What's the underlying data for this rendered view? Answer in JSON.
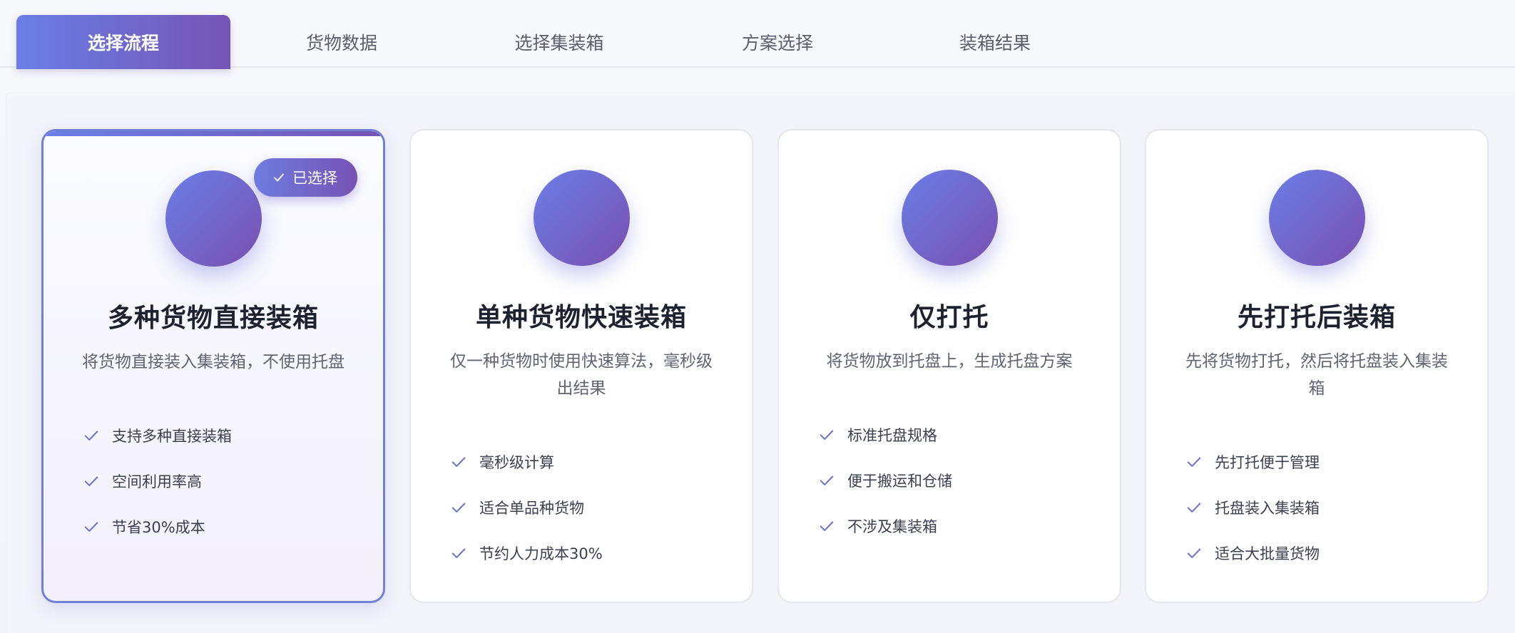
{
  "tabs": [
    {
      "label": "选择流程",
      "active": true
    },
    {
      "label": "货物数据",
      "active": false
    },
    {
      "label": "选择集装箱",
      "active": false
    },
    {
      "label": "方案选择",
      "active": false
    },
    {
      "label": "装箱结果",
      "active": false
    }
  ],
  "badge": {
    "label": "已选择",
    "icon": "check-icon"
  },
  "cards": [
    {
      "title": "多种货物直接装箱",
      "description": "将货物直接装入集装箱，不使用托盘",
      "selected": true,
      "icon": "circle-icon",
      "features": [
        "支持多种直接装箱",
        "空间利用率高",
        "节省30%成本"
      ]
    },
    {
      "title": "单种货物快速装箱",
      "description": "仅一种货物时使用快速算法，毫秒级出结果",
      "selected": false,
      "icon": "circle-icon",
      "features": [
        "毫秒级计算",
        "适合单品种货物",
        "节约人力成本30%"
      ]
    },
    {
      "title": "仅打托",
      "description": "将货物放到托盘上，生成托盘方案",
      "selected": false,
      "icon": "circle-icon",
      "features": [
        "标准托盘规格",
        "便于搬运和仓储",
        "不涉及集装箱"
      ]
    },
    {
      "title": "先打托后装箱",
      "description": "先将货物打托，然后将托盘装入集装箱",
      "selected": false,
      "icon": "circle-icon",
      "features": [
        "先打托便于管理",
        "托盘装入集装箱",
        "适合大批量货物"
      ]
    }
  ],
  "colors": {
    "accent_start": "#6a7fe6",
    "accent_end": "#7555b4",
    "check": "#6b73c9",
    "title": "#1d2230"
  }
}
